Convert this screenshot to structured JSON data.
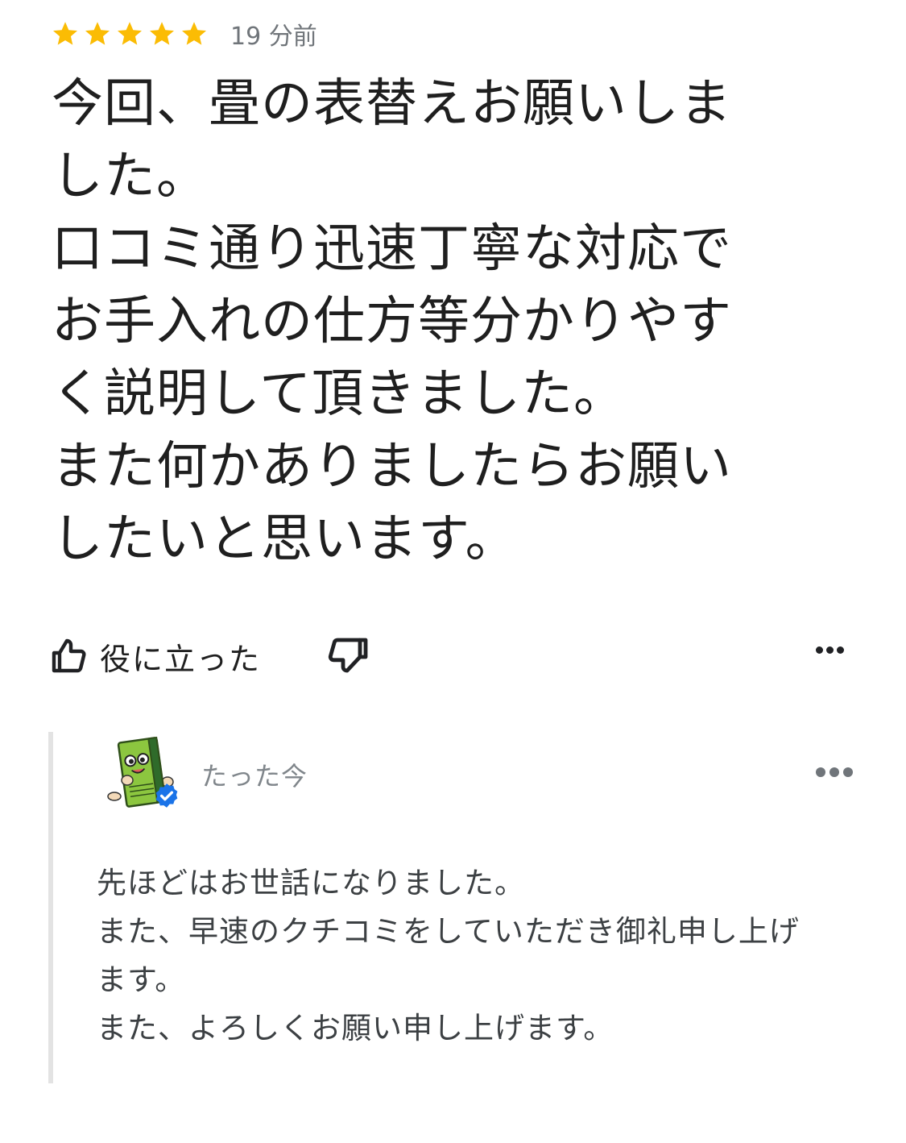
{
  "review": {
    "rating": 5,
    "rating_max": 5,
    "star_color": "#FBBC04",
    "time": "19 分前",
    "text_lines": [
      "今回、畳の表替えお願いしま",
      "した。",
      "口コミ通り迅速丁寧な対応で",
      "お手入れの仕方等分かりやす",
      "く説明して頂きました。",
      "また何かありましたらお願い",
      "したいと思います。"
    ]
  },
  "actions": {
    "helpful_label": "役に立った",
    "helpful_icon": "thumbs-up-outline-icon",
    "not_helpful_icon": "thumbs-down-outline-icon",
    "more_icon": "more-horizontal-icon"
  },
  "owner_reply": {
    "time": "たった今",
    "avatar_icon": "tatami-mascot-avatar",
    "verified_icon": "verified-badge-icon",
    "verified_color": "#1A73E8",
    "text_lines": [
      "先ほどはお世話になりました。",
      "また、早速のクチコミをしていただき御礼申し上げ",
      "ます。",
      "また、よろしくお願い申し上げます。"
    ]
  }
}
